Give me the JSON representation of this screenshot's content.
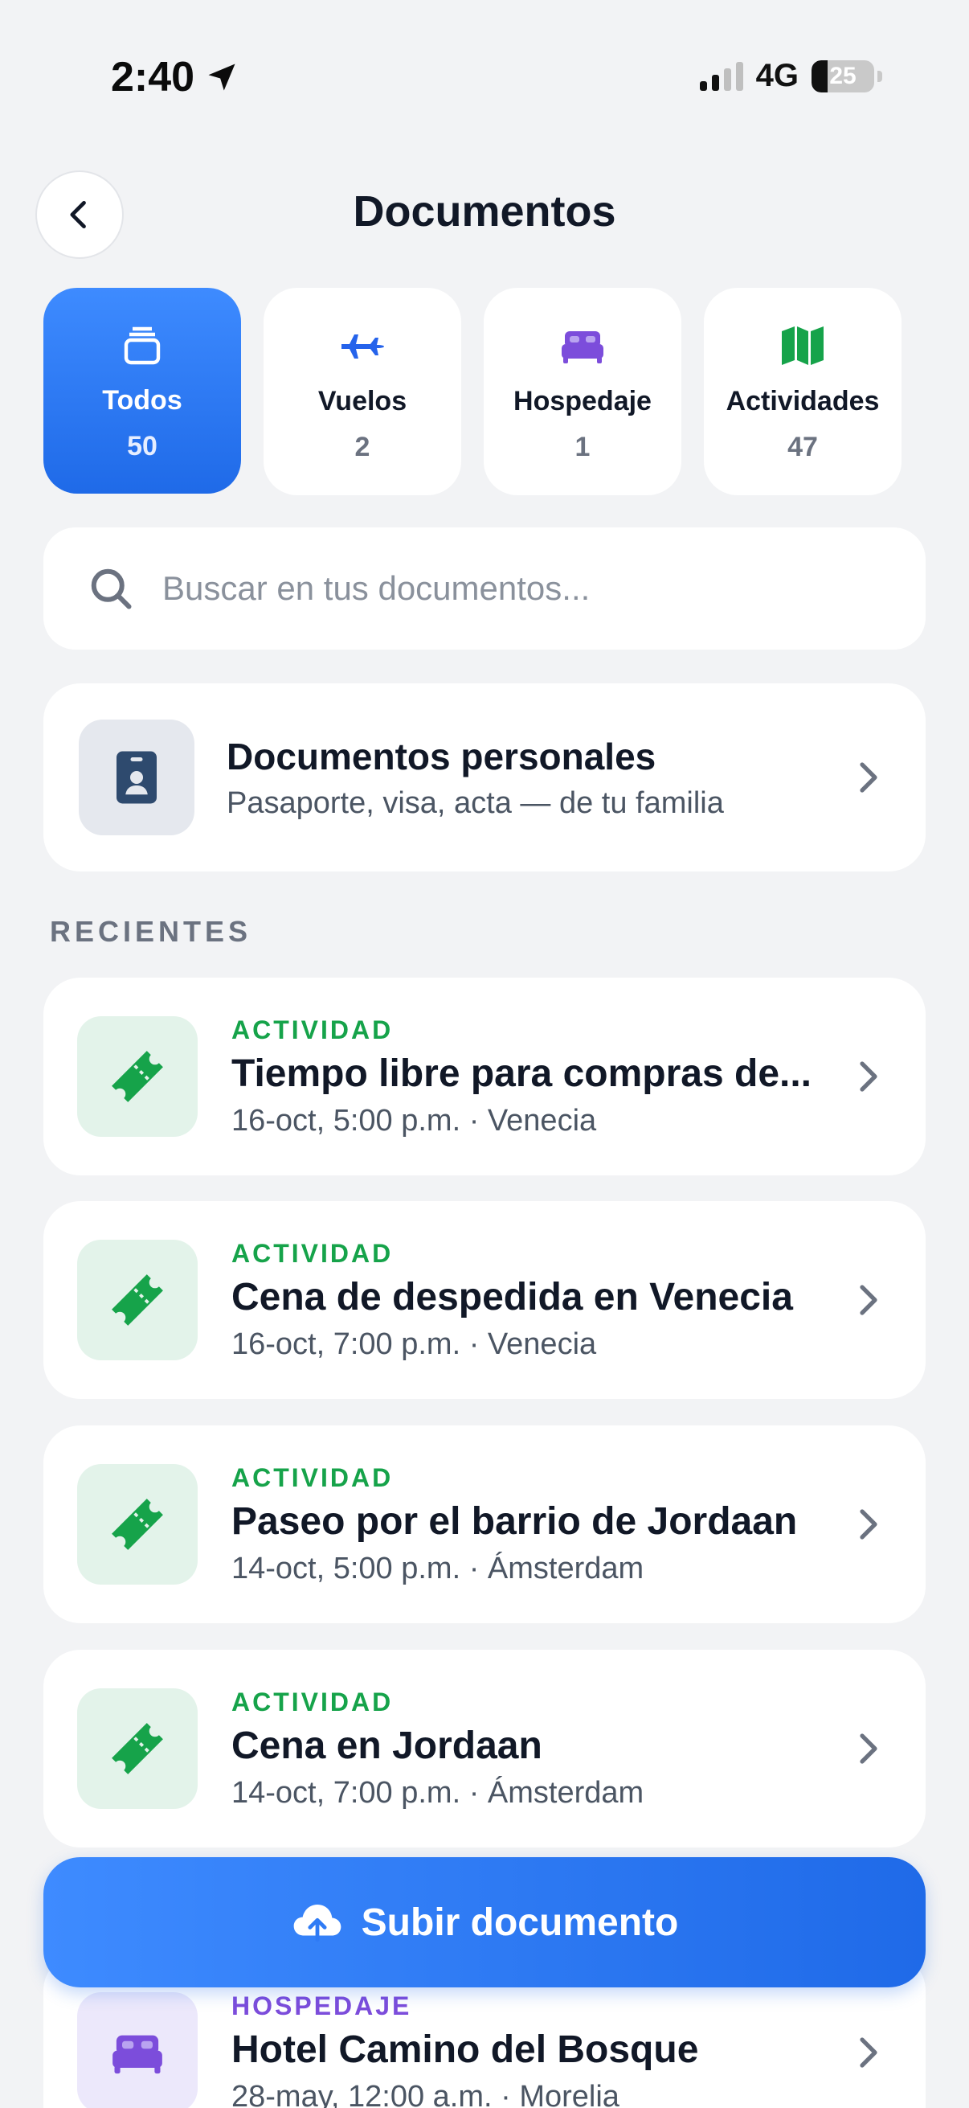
{
  "status_bar": {
    "time": "2:40",
    "network": "4G",
    "battery": "25",
    "battery_level": 0.25
  },
  "header": {
    "title": "Documentos",
    "back_icon": "chevron-left-icon"
  },
  "tabs": [
    {
      "label": "Todos",
      "count": "50",
      "icon": "stack-icon",
      "active": true
    },
    {
      "label": "Vuelos",
      "count": "2",
      "icon": "airplane-icon",
      "color": "#2563EB"
    },
    {
      "label": "Hospedaje",
      "count": "1",
      "icon": "bed-icon",
      "color": "#7C4DDB"
    },
    {
      "label": "Actividades",
      "count": "47",
      "icon": "map-icon",
      "color": "#16A34A"
    }
  ],
  "search": {
    "placeholder": "Buscar en tus documentos..."
  },
  "personal_docs": {
    "title": "Documentos personales",
    "subtitle": "Pasaporte, visa, acta — de tu familia"
  },
  "section_label": "RECIENTES",
  "items": [
    {
      "category": "ACTIVIDAD",
      "name": "Tiempo libre para compras de...",
      "meta": "16-oct, 5:00 p.m. · Venecia",
      "icon": "ticket-icon"
    },
    {
      "category": "ACTIVIDAD",
      "name": "Cena de despedida en Venecia",
      "meta": "16-oct, 7:00 p.m. · Venecia",
      "icon": "ticket-icon"
    },
    {
      "category": "ACTIVIDAD",
      "name": "Paseo por el barrio de Jordaan",
      "meta": "14-oct, 5:00 p.m. · Ámsterdam",
      "icon": "ticket-icon"
    },
    {
      "category": "ACTIVIDAD",
      "name": "Cena en Jordaan",
      "meta": "14-oct, 7:00 p.m. · Ámsterdam",
      "icon": "ticket-icon"
    },
    {
      "category": "HOSPEDAJE",
      "name": "Hotel Camino del Bosque",
      "meta": "28-may, 12:00 a.m. · Morelia",
      "icon": "bed-icon"
    }
  ],
  "upload_button": {
    "label": "Subir documento",
    "icon": "cloud-upload-icon"
  },
  "colors": {
    "accent": "#2F7BF5",
    "activity": "#16A34A",
    "lodging": "#7C4DDB",
    "background": "#F2F3F5"
  }
}
